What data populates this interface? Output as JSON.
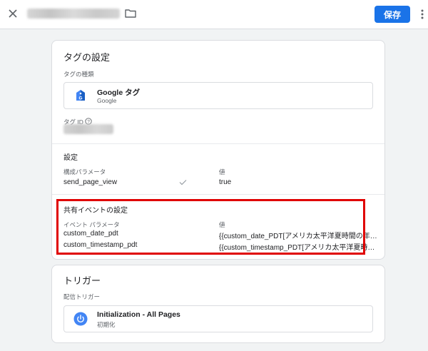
{
  "header": {
    "save_label": "保存",
    "icons": [
      "close-icon",
      "folder-icon",
      "more-vert-icon"
    ]
  },
  "tag_config": {
    "title": "タグの設定",
    "type_label": "タグの種類",
    "type_name": "Google タグ",
    "type_vendor": "Google",
    "id_label": "タグ ID",
    "settings": {
      "title": "設定",
      "param_header": "構成パラメータ",
      "value_header": "値",
      "rows": [
        {
          "param": "send_page_view",
          "value": "true",
          "checked": true
        }
      ]
    },
    "shared_events": {
      "title": "共有イベントの設定",
      "param_header": "イベント パラメータ",
      "value_header": "値",
      "rows": [
        {
          "param": "custom_date_pdt",
          "value": "{{custom_date_PDT[アメリカ太平洋夏時間の年…"
        },
        {
          "param": "custom_timestamp_pdt",
          "value": "{{custom_timestamp_PDT[アメリカ太平洋夏時…"
        }
      ]
    }
  },
  "trigger": {
    "title": "トリガー",
    "firing_label": "配信トリガー",
    "name": "Initialization - All Pages",
    "subtitle": "初期化"
  },
  "colors": {
    "accent": "#1a73e8",
    "highlight": "#e00000",
    "trigger_icon": "#4285f4"
  }
}
